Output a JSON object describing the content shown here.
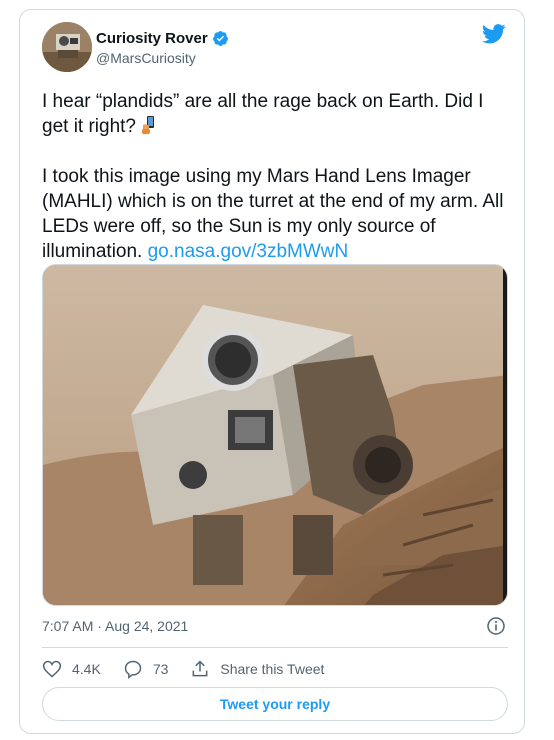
{
  "author": {
    "name": "Curiosity Rover",
    "handle": "@MarsCuriosity",
    "verified_icon": "verified-badge-icon"
  },
  "tweet": {
    "line1": "I hear “plandids” are all the rage back on Earth. Did I get it right? ",
    "line2": "I took this image using my Mars Hand Lens Imager (MAHLI) which is on the turret at the end of my arm. All LEDs were off, so the Sun is my only source of illumination. ",
    "link": "go.nasa.gov/3zbMWwN",
    "emoji": "selfie-hand-icon"
  },
  "media": {
    "subject": "rover-selfie-image"
  },
  "meta": {
    "timestamp": "7:07 AM · Aug 24, 2021"
  },
  "actions": {
    "likes": "4.4K",
    "replies": "73",
    "share_label": "Share this Tweet"
  },
  "reply": {
    "label": "Tweet your reply"
  },
  "colors": {
    "accent": "#1d9bf0",
    "text": "#0f1419",
    "muted": "#536471",
    "border": "#cfd9de"
  }
}
